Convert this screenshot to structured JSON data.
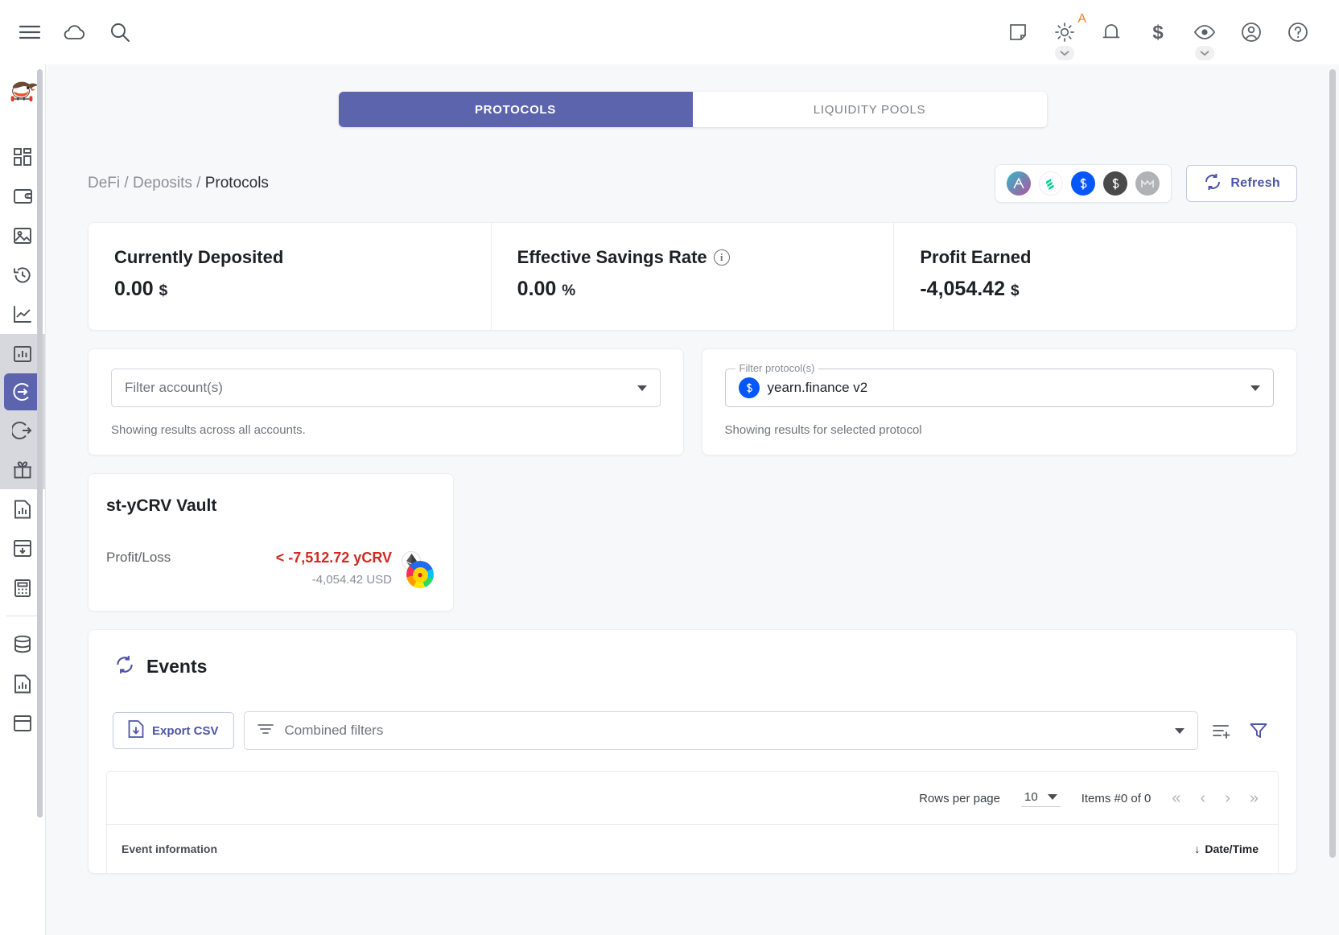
{
  "topbar": {
    "left_icons": [
      {
        "name": "menu-icon",
        "label": "Menu"
      },
      {
        "name": "cloud-icon",
        "label": "Cloud sync"
      },
      {
        "name": "search-icon",
        "label": "Search"
      }
    ],
    "right_icons": [
      {
        "name": "note-icon",
        "label": "Notes"
      },
      {
        "name": "theme-sun-icon",
        "label": "Theme",
        "badge": "A"
      },
      {
        "name": "notification-bell-icon",
        "label": "Notifications"
      },
      {
        "name": "dollar-icon",
        "label": "Currency"
      },
      {
        "name": "eye-privacy-icon",
        "label": "Privacy mode"
      },
      {
        "name": "account-icon",
        "label": "Account"
      },
      {
        "name": "help-icon",
        "label": "Help"
      }
    ]
  },
  "sidebar": {
    "logo": "robin-bird-logo",
    "items": [
      {
        "name": "dashboard",
        "icon": "dashboard-grid-icon",
        "active": false,
        "group": false
      },
      {
        "name": "accounts",
        "icon": "wallet-icon",
        "active": false,
        "group": false
      },
      {
        "name": "nfts",
        "icon": "image-icon",
        "active": false,
        "group": false
      },
      {
        "name": "history",
        "icon": "history-clock-icon",
        "active": false,
        "group": false
      },
      {
        "name": "statistics",
        "icon": "line-chart-icon",
        "active": false,
        "group": false
      },
      {
        "name": "defi-overview",
        "icon": "bar-chart-box-icon",
        "active": false,
        "group": true
      },
      {
        "name": "defi-deposits",
        "icon": "arrow-into-circle-icon",
        "active": true,
        "group": true
      },
      {
        "name": "defi-liabilities",
        "icon": "arrow-out-circle-icon",
        "active": false,
        "group": true
      },
      {
        "name": "defi-airdrops",
        "icon": "gift-icon",
        "active": false,
        "group": true
      },
      {
        "name": "reports",
        "icon": "report-doc-icon",
        "active": false,
        "group": false
      },
      {
        "name": "import-data",
        "icon": "archive-down-icon",
        "active": false,
        "group": false
      },
      {
        "name": "calculator",
        "icon": "calculator-icon",
        "active": false,
        "group": false
      },
      {
        "name": "database",
        "icon": "database-icon",
        "active": false,
        "group": false
      },
      {
        "name": "reports-2",
        "icon": "report-doc-icon",
        "active": false,
        "group": false
      },
      {
        "name": "notes",
        "icon": "note-panel-icon",
        "active": false,
        "group": false
      }
    ]
  },
  "tabs": [
    {
      "label": "PROTOCOLS",
      "active": true
    },
    {
      "label": "LIQUIDITY POOLS",
      "active": false
    }
  ],
  "breadcrumb": {
    "root": "DeFi",
    "sep": "/",
    "middle": "Deposits",
    "current": "Protocols",
    "full": "DeFi / Deposits / Protocols"
  },
  "protocol_icons": [
    {
      "name": "aave-icon",
      "glyph": "Ʌ",
      "bg": "linear-gradient(135deg,#2ebac6,#b6509e)",
      "color": "#ffffff"
    },
    {
      "name": "compound-icon",
      "glyph": "≡",
      "bg": "#ffffff",
      "color": "#00d395"
    },
    {
      "name": "yearn-v2-icon",
      "glyph": "§",
      "bg": "#0657f9",
      "color": "#ffffff"
    },
    {
      "name": "yearn-v3-icon",
      "glyph": "§",
      "bg": "#4a4a4a",
      "color": "#ffffff"
    },
    {
      "name": "makerdao-icon",
      "glyph": "M",
      "bg": "#b0b2b5",
      "color": "#e6e7e9"
    }
  ],
  "refresh_button": "Refresh",
  "stats": [
    {
      "title": "Currently Deposited",
      "value": "0.00",
      "unit": "$",
      "has_info": false
    },
    {
      "title": "Effective Savings Rate",
      "value": "0.00",
      "unit": "%",
      "has_info": true
    },
    {
      "title": "Profit Earned",
      "value": "-4,054.42",
      "unit": "$",
      "has_info": false
    }
  ],
  "filters": {
    "accounts": {
      "placeholder": "Filter account(s)",
      "helper": "Showing results across all accounts."
    },
    "protocols": {
      "legend": "Filter protocol(s)",
      "value": "yearn.finance v2",
      "helper": "Showing results for selected protocol"
    }
  },
  "vault": {
    "title": "st-yCRV Vault",
    "pl_label": "Profit/Loss",
    "pl_amount": "< -7,512.72 yCRV",
    "pl_usd": "-4,054.42 USD",
    "chain_icon": "ethereum-icon",
    "wallet_icon": "rainbow-wallet-icon"
  },
  "events": {
    "title": "Events",
    "export_label": "Export CSV",
    "filters_placeholder": "Combined filters",
    "pager": {
      "rows_label": "Rows per page",
      "rows_value": "10",
      "items_label": "Items #0 of 0",
      "first": "«",
      "prev": "‹",
      "next": "›",
      "last": "»"
    },
    "columns": [
      {
        "label": "Event information",
        "align": "left"
      },
      {
        "label": "Date/Time",
        "align": "right",
        "sort": "↓"
      }
    ]
  },
  "colors": {
    "accent": "#5c64ae",
    "negative": "#cf2a20",
    "page_bg": "#f7f8fa"
  }
}
